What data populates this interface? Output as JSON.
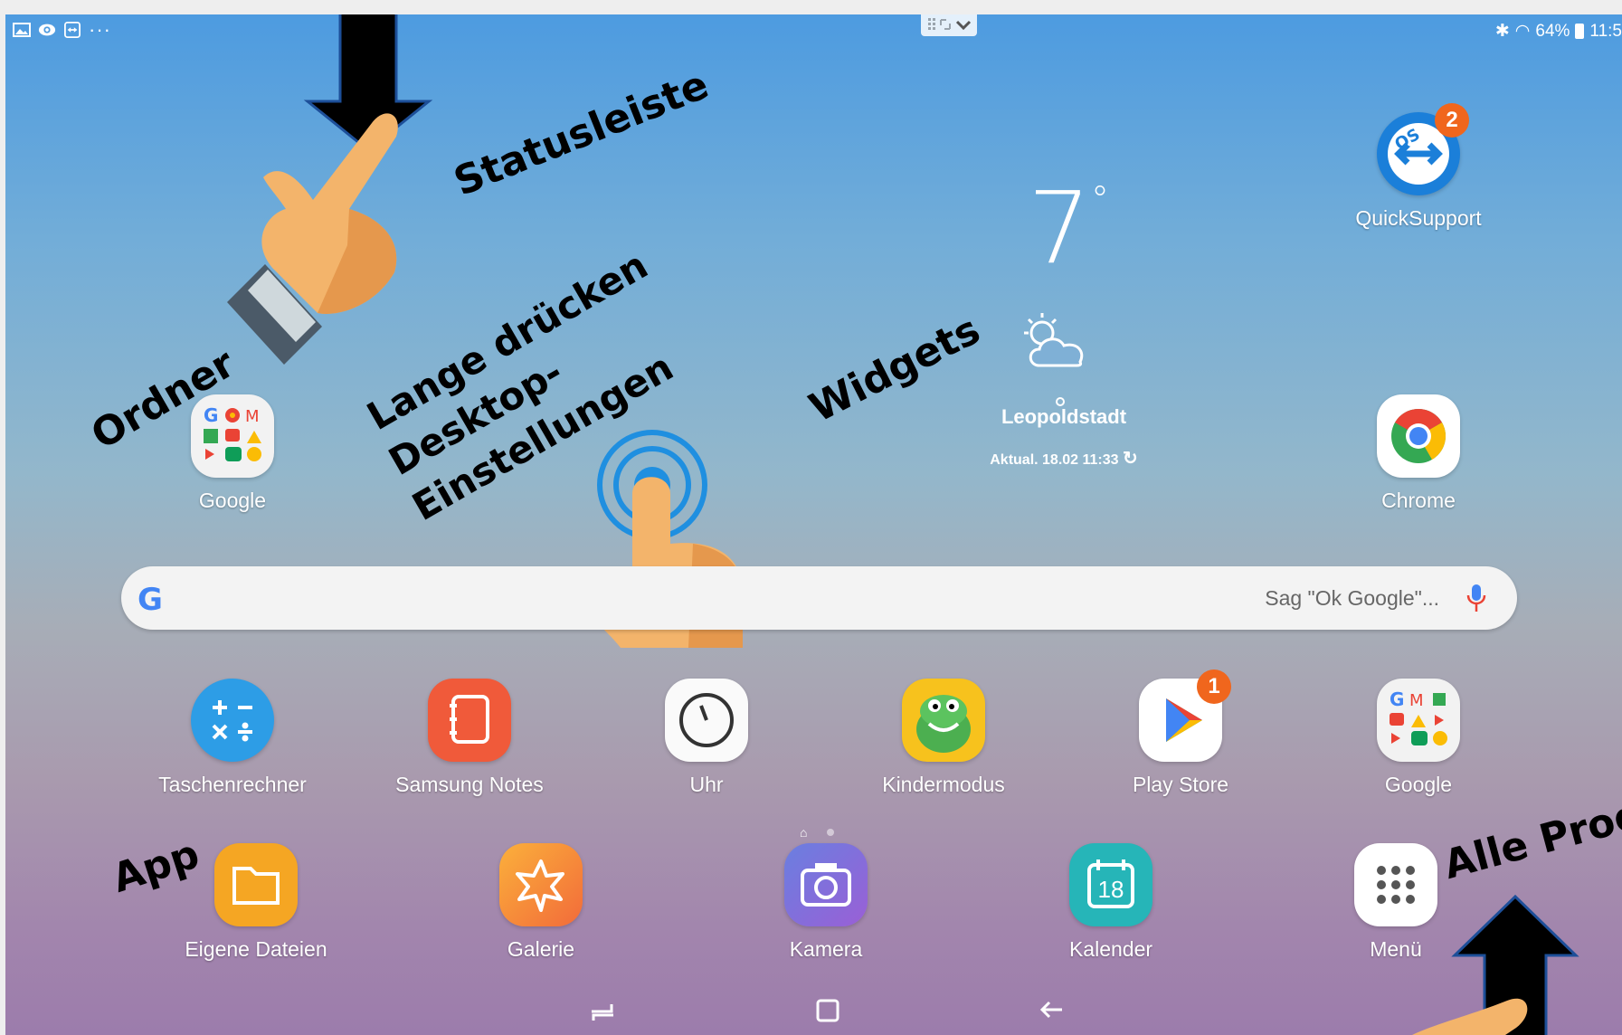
{
  "status_bar": {
    "left_icons": [
      "gallery-icon",
      "eye-icon",
      "teamviewer-icon",
      "more-icon"
    ],
    "battery": "64%",
    "time": "11:5"
  },
  "annotations": {
    "statusleiste": "Statusleiste",
    "ordner": "Ordner",
    "long_press_line1": "Lange drücken",
    "long_press_line2": "Desktop-",
    "long_press_line3": "Einstellungen",
    "widgets": "Widgets",
    "app": "App",
    "alle_programme": "Alle Progr"
  },
  "weather": {
    "temperature": "7",
    "degree": "°",
    "location": "Leopoldstadt",
    "updated": "Aktual. 18.02 11:33"
  },
  "apps_top": {
    "quicksupport": {
      "label": "QuickSupport",
      "badge": "2"
    },
    "google_folder": {
      "label": "Google"
    },
    "chrome": {
      "label": "Chrome"
    }
  },
  "search": {
    "placeholder": "Sag \"Ok Google\"..."
  },
  "apps_row": [
    {
      "label": "Taschenrechner"
    },
    {
      "label": "Samsung Notes"
    },
    {
      "label": "Uhr"
    },
    {
      "label": "Kindermodus"
    },
    {
      "label": "Play Store",
      "badge": "1"
    },
    {
      "label": "Google"
    }
  ],
  "dock": [
    {
      "label": "Eigene Dateien"
    },
    {
      "label": "Galerie"
    },
    {
      "label": "Kamera"
    },
    {
      "label": "Kalender",
      "day": "18"
    },
    {
      "label": "Menü"
    }
  ],
  "colors": {
    "badge": "#f0661d",
    "google_blue": "#4285f4",
    "google_red": "#ea4335",
    "google_yellow": "#fbbc05",
    "google_green": "#34a853"
  }
}
